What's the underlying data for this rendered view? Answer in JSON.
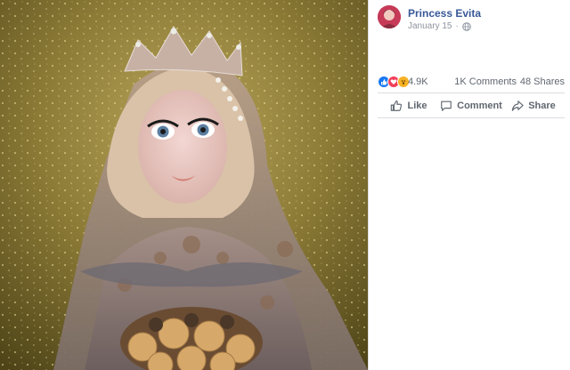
{
  "post": {
    "author": "Princess Evita",
    "date": "January 15",
    "audience_icon": "globe-icon"
  },
  "reactions": {
    "icons": [
      "like-reaction-icon",
      "love-reaction-icon",
      "wow-reaction-icon"
    ],
    "count": "4.9K",
    "comments": "1K Comments",
    "shares": "48 Shares"
  },
  "actions": {
    "like_label": "Like",
    "comment_label": "Comment",
    "share_label": "Share"
  },
  "colors": {
    "brand_link": "#385898",
    "muted_text": "#606770",
    "like_blue": "#1877f2",
    "love_red": "#f33e58",
    "wow_yellow": "#f7b125"
  }
}
